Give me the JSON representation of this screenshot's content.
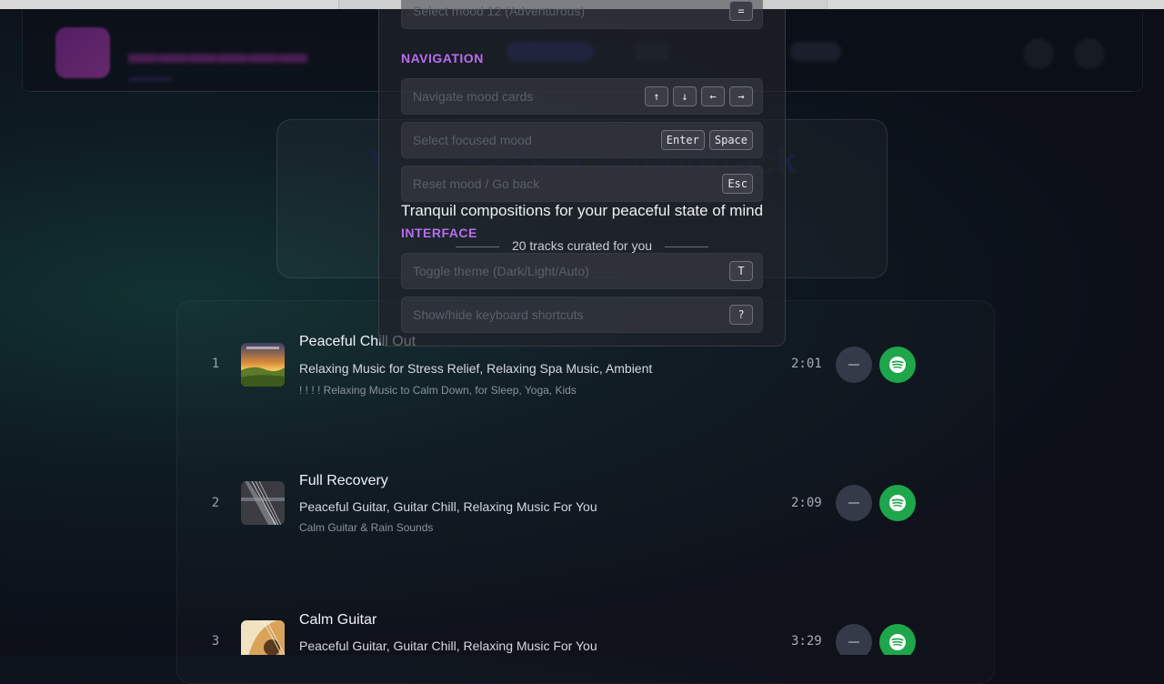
{
  "hero": {
    "title": "Your Perfect Soundtrack",
    "subtitle": "Tranquil compositions for your peaceful state of mind",
    "track_count": "20 tracks curated for you"
  },
  "tracks": [
    {
      "num": "1",
      "title": "Peaceful Chill Out",
      "artist": "Relaxing Music for Stress Relief, Relaxing Spa Music, Ambient",
      "album": "! ! ! ! Relaxing Music to Calm Down, for Sleep, Yoga, Kids",
      "duration": "2:01",
      "cover": "sunset-landscape"
    },
    {
      "num": "2",
      "title": "Full Recovery",
      "artist": "Peaceful Guitar, Guitar Chill, Relaxing Music For You",
      "album": "Calm Guitar & Rain Sounds",
      "duration": "2:09",
      "cover": "guitar-strings"
    },
    {
      "num": "3",
      "title": "Calm Guitar",
      "artist": "Peaceful Guitar, Guitar Chill, Relaxing Music For You",
      "album": "",
      "duration": "3:29",
      "cover": "acoustic-guitar"
    }
  ],
  "shortcuts": {
    "partial_row": {
      "desc": "Select mood 12 (Adventurous)",
      "keys": [
        "="
      ]
    },
    "navigation_label": "NAVIGATION",
    "navigation": [
      {
        "desc": "Navigate mood cards",
        "keys": [
          "↑",
          "↓",
          "←",
          "→"
        ]
      },
      {
        "desc": "Select focused mood",
        "keys": [
          "Enter",
          "Space"
        ]
      },
      {
        "desc": "Reset mood / Go back",
        "keys": [
          "Esc"
        ]
      }
    ],
    "interface_label": "INTERFACE",
    "interface": [
      {
        "desc": "Toggle theme (Dark/Light/Auto)",
        "keys": [
          "T"
        ]
      },
      {
        "desc": "Show/hide keyboard shortcuts",
        "keys": [
          "?"
        ]
      }
    ]
  },
  "icons": {
    "remove": "minus-icon",
    "spotify": "spotify-icon"
  },
  "colors": {
    "accent": "#b86df0",
    "spotify": "#1ea64a"
  }
}
